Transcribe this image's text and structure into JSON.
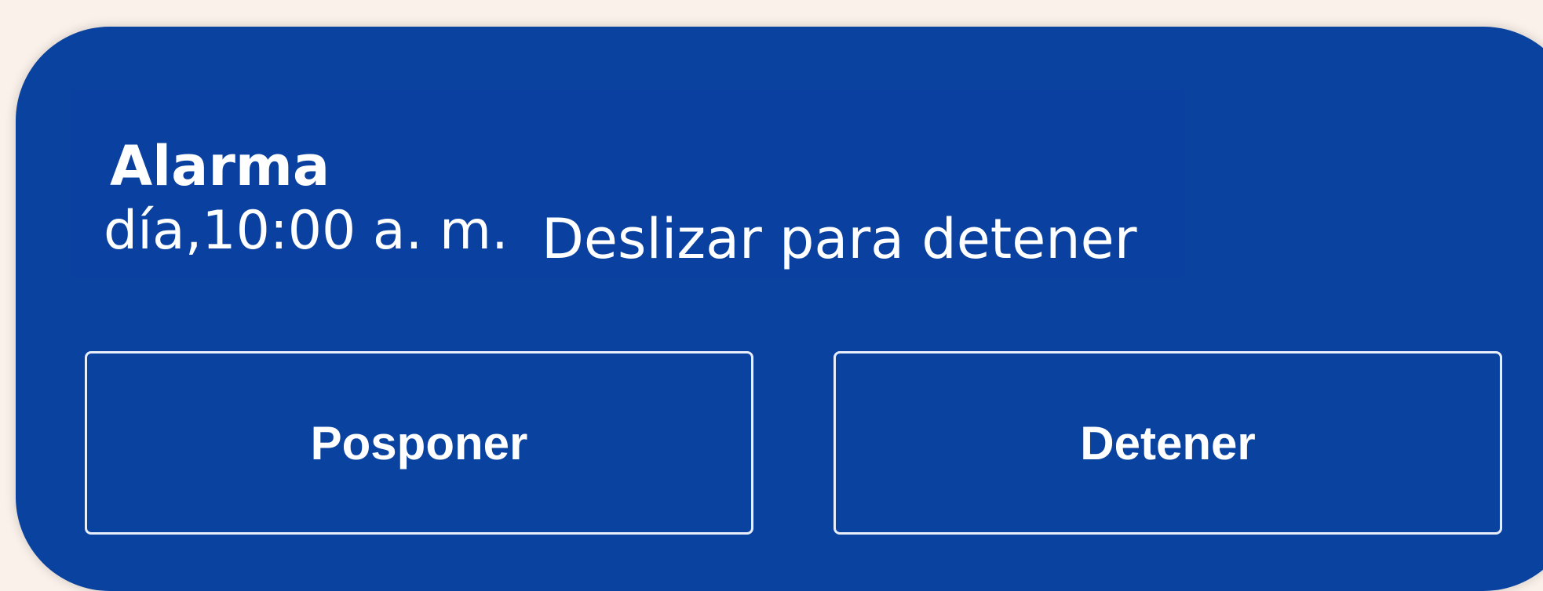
{
  "notification": {
    "title": "Alarma",
    "time": "día,10:00 a. m.",
    "hint": "Deslizar para detener",
    "snooze_label": "Posponer",
    "stop_label": "Detener"
  },
  "colors": {
    "background": "#faf1ea",
    "card": "#0a42a0",
    "text": "#ffffff",
    "button_border": "#e8eefb"
  }
}
